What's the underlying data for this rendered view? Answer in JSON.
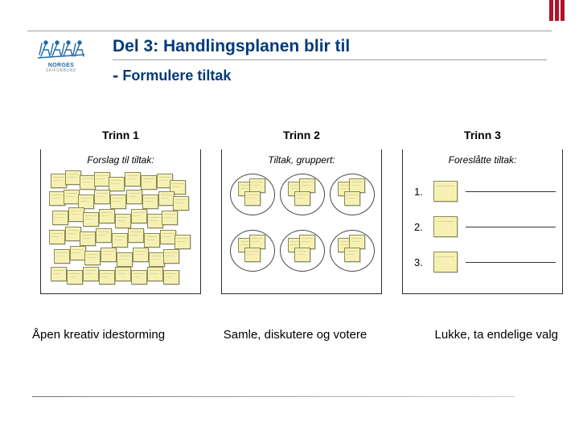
{
  "brand": {
    "top_word": "NORGES",
    "sub_word": "SKIFORBUND"
  },
  "title": {
    "main": "Del 3: Handlingsplanen blir til",
    "sub_dash": "-",
    "sub": "Formulere tiltak"
  },
  "steps": [
    {
      "title": "Trinn 1",
      "panel_heading": "Forslag til tiltak:",
      "caption": "Åpen kreativ idestorming"
    },
    {
      "title": "Trinn 2",
      "panel_heading": "Tiltak, gruppert:",
      "caption": "Samle, diskutere og votere"
    },
    {
      "title": "Trinn 3",
      "panel_heading": "Foreslåtte tiltak:",
      "caption": "Lukke, ta endelige valg",
      "ranks": [
        "1.",
        "2.",
        "3."
      ]
    }
  ],
  "colors": {
    "brand_blue": "#003a7a",
    "accent_red": "#b0132a",
    "sticky": "#f6f1b2"
  }
}
